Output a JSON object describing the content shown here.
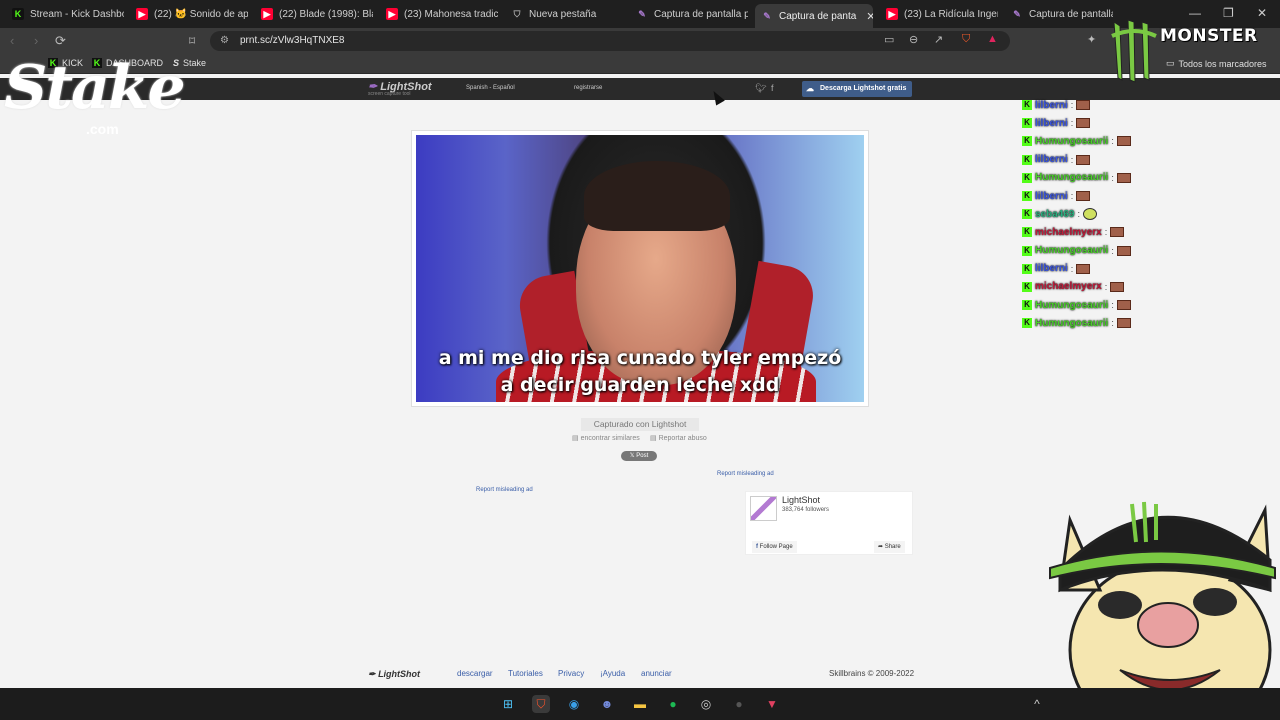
{
  "browser": {
    "tabs": [
      {
        "label": "Stream - Kick Dashbo",
        "icon": "kick-icon",
        "active": false
      },
      {
        "label": "(22) 🐱 Sonido de ap",
        "icon": "youtube-icon",
        "active": false
      },
      {
        "label": "(22) Blade (1998): Bla",
        "icon": "youtube-icon",
        "active": false
      },
      {
        "label": "(23) Mahonesa tradic",
        "icon": "youtube-icon",
        "active": false
      },
      {
        "label": "Nueva pestaña",
        "icon": "brave-shield-icon",
        "active": false
      },
      {
        "label": "Captura de pantalla p",
        "icon": "lightshot-icon",
        "active": false
      },
      {
        "label": "Captura de panta",
        "icon": "lightshot-icon",
        "active": true
      },
      {
        "label": "(23) La Ridícula Ingen",
        "icon": "youtube-icon",
        "active": false
      },
      {
        "label": "Captura de pantalla p",
        "icon": "lightshot-icon",
        "active": false
      }
    ],
    "url": "prnt.sc/zVlw3HqTNXE8",
    "bookmarks": [
      {
        "label": "KICK",
        "icon": "kick-icon"
      },
      {
        "label": "DASHBOARD",
        "icon": "kick-icon"
      },
      {
        "label": "Stake",
        "icon": "stake-icon"
      }
    ],
    "all_bookmarks_label": "Todos los marcadores"
  },
  "lightshot": {
    "logo": "LightShot",
    "logo_sub": "screen capture tool",
    "language": "Spanish - Español",
    "register": "registrarse",
    "download_button": "Descarga Lightshot gratis",
    "subtitle_line1": "a mi me dio risa cunado tyler empezó",
    "subtitle_line2": "a decir guarden leche xdd",
    "captured_with": "Capturado con Lightshot",
    "find_similar": "encontrar similares",
    "report_abuse": "Reportar abuso",
    "post_button": "𝕏 Post",
    "report_ad_1": "Report misleading ad",
    "report_ad_2": "Report misleading ad",
    "fb_page_name": "LightShot",
    "fb_followers": "383,764 followers",
    "fb_follow": "Follow Page",
    "fb_share": "Share",
    "footer_logo": "LightShot",
    "footer_links": [
      "descargar",
      "Tutoriales",
      "Privacy",
      "¡Ayuda",
      "anunciar"
    ],
    "footer_copyright": "Skillbrains © 2009-2022"
  },
  "overlay": {
    "stake_logo": "Stake",
    "stake_com": ".com",
    "monster_text": "MONSTER",
    "chat": [
      {
        "user": "lilberni",
        "color": "#3a55e0",
        "emote": "brown"
      },
      {
        "user": "lilberni",
        "color": "#3a55e0",
        "emote": "brown"
      },
      {
        "user": "Humungosaurii",
        "color": "#4ad02a",
        "emote": "brown"
      },
      {
        "user": "lilberni",
        "color": "#3a55e0",
        "emote": "brown"
      },
      {
        "user": "Humungosaurii",
        "color": "#4ad02a",
        "emote": "brown"
      },
      {
        "user": "lilberni",
        "color": "#3a55e0",
        "emote": "brown"
      },
      {
        "user": "seba469",
        "color": "#2ab080",
        "emote": "yellow"
      },
      {
        "user": "michaelmyerx",
        "color": "#c01a3a",
        "emote": "brown"
      },
      {
        "user": "Humungosaurii",
        "color": "#4ad02a",
        "emote": "brown"
      },
      {
        "user": "lilberni",
        "color": "#3a55e0",
        "emote": "brown"
      },
      {
        "user": "michaelmyerx",
        "color": "#c01a3a",
        "emote": "brown"
      },
      {
        "user": "Humungosaurii",
        "color": "#4ad02a",
        "emote": "brown"
      },
      {
        "user": "Humungosaurii",
        "color": "#4ad02a",
        "emote": "brown"
      }
    ]
  },
  "colors": {
    "kick_green": "#53fc18",
    "lightshot_blue": "#3f5d8a",
    "link_blue": "#3a5ea8"
  }
}
